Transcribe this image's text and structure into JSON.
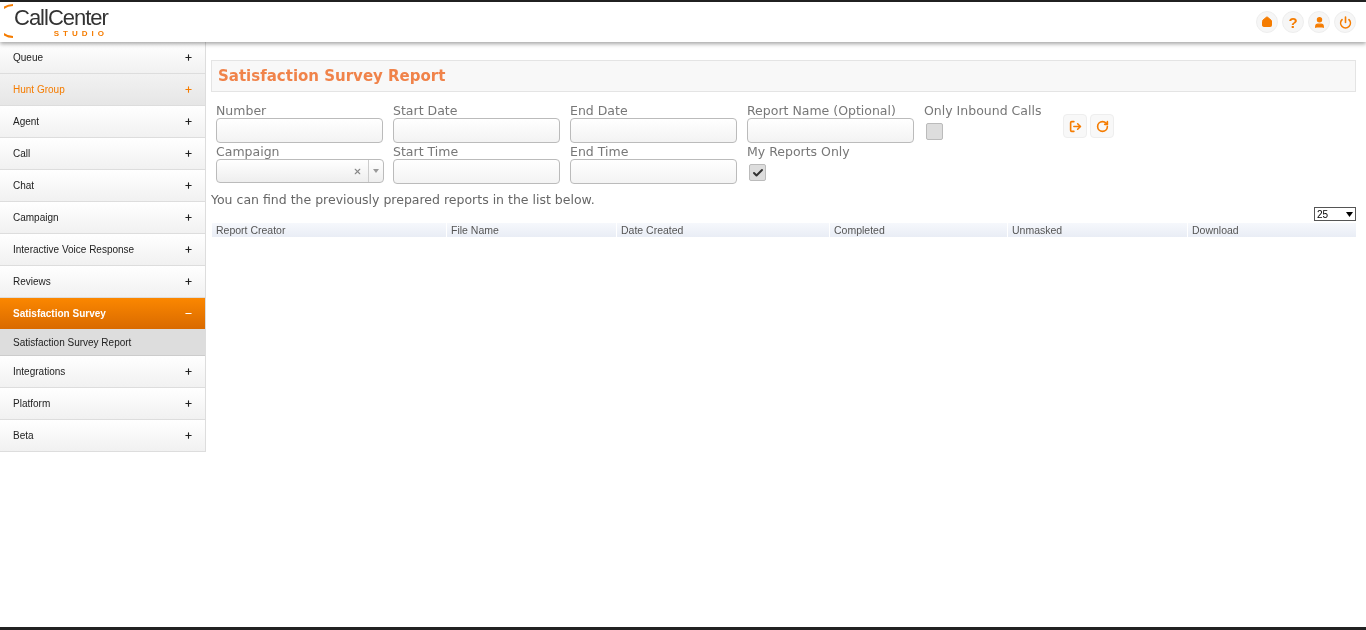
{
  "logo": {
    "name": "CallCenter",
    "tagline": "STUDIO"
  },
  "sidebar": {
    "items": [
      {
        "label": "Queue",
        "expanded": false,
        "selected": false,
        "highlighted": false
      },
      {
        "label": "Hunt Group",
        "expanded": false,
        "selected": false,
        "highlighted": true
      },
      {
        "label": "Agent",
        "expanded": false,
        "selected": false,
        "highlighted": false
      },
      {
        "label": "Call",
        "expanded": false,
        "selected": false,
        "highlighted": false
      },
      {
        "label": "Chat",
        "expanded": false,
        "selected": false,
        "highlighted": false
      },
      {
        "label": "Campaign",
        "expanded": false,
        "selected": false,
        "highlighted": false
      },
      {
        "label": "Interactive Voice Response",
        "expanded": false,
        "selected": false,
        "highlighted": false
      },
      {
        "label": "Reviews",
        "expanded": false,
        "selected": false,
        "highlighted": false
      },
      {
        "label": "Satisfaction Survey",
        "expanded": true,
        "selected": true,
        "highlighted": false,
        "children": [
          {
            "label": "Satisfaction Survey Report",
            "selected": true
          }
        ]
      },
      {
        "label": "Integrations",
        "expanded": false,
        "selected": false,
        "highlighted": false
      },
      {
        "label": "Platform",
        "expanded": false,
        "selected": false,
        "highlighted": false
      },
      {
        "label": "Beta",
        "expanded": false,
        "selected": false,
        "highlighted": false
      }
    ]
  },
  "help_label": "?",
  "page_title": "Satisfaction Survey Report",
  "filters": [
    {
      "kind": "text",
      "label": "Number"
    },
    {
      "kind": "text",
      "label": "Start Date"
    },
    {
      "kind": "text",
      "label": "End Date"
    },
    {
      "kind": "text",
      "label": "Report Name (Optional)"
    },
    {
      "kind": "checkbox",
      "label": "Only Inbound Calls",
      "checked": false
    },
    {
      "kind": "select",
      "label": "Campaign"
    },
    {
      "kind": "text",
      "label": "Start Time"
    },
    {
      "kind": "text",
      "label": "End Time"
    },
    {
      "kind": "checkbox",
      "label": "My Reports Only",
      "checked": true
    }
  ],
  "hint": "You can find the previously prepared reports in the list below.",
  "page_size": "25",
  "table": {
    "columns": [
      "Report Creator",
      "File Name",
      "Date Created",
      "Completed",
      "Unmasked",
      "Download"
    ]
  }
}
